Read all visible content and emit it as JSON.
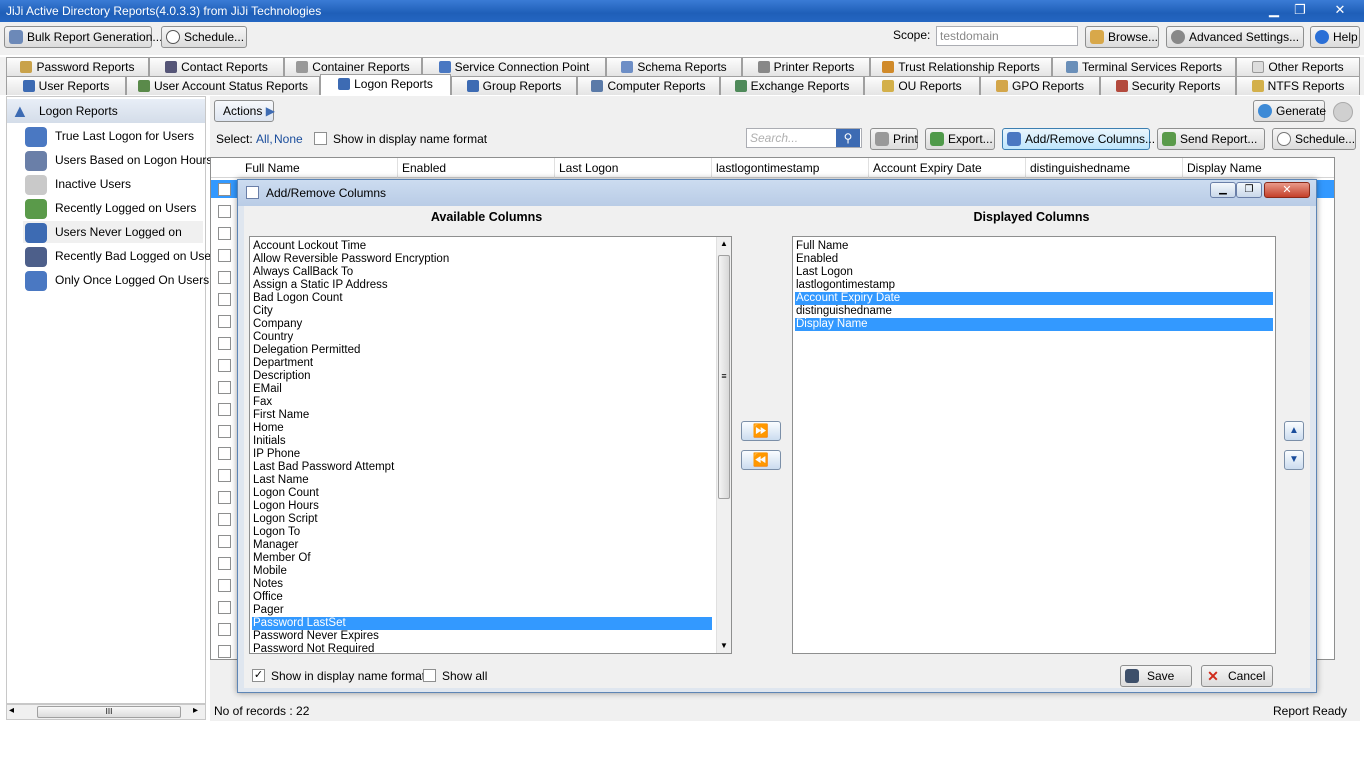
{
  "window": {
    "title": "JiJi Active Directory Reports(4.0.3.3) from JiJi Technologies",
    "min": "▁",
    "max": "❐",
    "close": "✕"
  },
  "toolbar": {
    "bulk": "Bulk Report Generation...",
    "schedule": "Schedule...",
    "scope_label": "Scope:",
    "scope_value": "testdomain",
    "browse": "Browse...",
    "advanced": "Advanced  Settings...",
    "help": "Help"
  },
  "tabs_row1": [
    "Password Reports",
    "Contact Reports",
    "Container Reports",
    "Service Connection Point",
    "Schema Reports",
    "Printer Reports",
    "Trust Relationship Reports",
    "Terminal Services Reports",
    "Other Reports"
  ],
  "tabs_row2": [
    "User Reports",
    "User Account Status Reports",
    "Logon Reports",
    "Group Reports",
    "Computer Reports",
    "Exchange Reports",
    "OU Reports",
    "GPO Reports",
    "Security Reports",
    "NTFS Reports"
  ],
  "active_tab": "Logon Reports",
  "sidebar": {
    "header": "Logon Reports",
    "items": [
      "True Last Logon for Users",
      "Users Based on Logon Hours",
      "Inactive Users",
      "Recently Logged on Users",
      "Users Never Logged on",
      "Recently Bad Logged on Users",
      "Only Once Logged On Users"
    ],
    "selected": "Users Never Logged on",
    "scroll_left": "◂",
    "scroll_right": "▸",
    "scroll_grip": "III"
  },
  "actions": {
    "label": "Actions",
    "arrow": "▶",
    "generate": "Generate"
  },
  "selectbar": {
    "select_label": "Select:",
    "all": "All,",
    "none": "None",
    "show_display": "Show in display name format",
    "search_placeholder": "Search...",
    "print": "Print",
    "export": "Export...",
    "addremove": "Add/Remove Columns...",
    "send": "Send Report...",
    "schedule": "Schedule..."
  },
  "grid": {
    "columns": [
      "Full Name",
      "Enabled",
      "Last Logon",
      "lastlogontimestamp",
      "Account Expiry Date",
      "distinguishedname",
      "Display Name"
    ]
  },
  "dialog": {
    "title": "Add/Remove Columns",
    "available_header": "Available Columns",
    "displayed_header": "Displayed Columns",
    "available": [
      "Account Lockout Time",
      "Allow Reversible Password Encryption",
      "Always CallBack To",
      "Assign a Static IP Address",
      "Bad Logon Count",
      "City",
      "Company",
      "Country",
      "Delegation Permitted",
      "Department",
      "Description",
      "EMail",
      "Fax",
      "First Name",
      "Home",
      "Initials",
      "IP Phone",
      "Last Bad Password Attempt",
      "Last Name",
      "Logon Count",
      "Logon Hours",
      "Logon Script",
      "Logon To",
      "Manager",
      "Member Of",
      "Mobile",
      "Notes",
      "Office",
      "Pager",
      "Password LastSet",
      "Password Never Expires",
      "Password Not Required"
    ],
    "available_selected": "Password LastSet",
    "displayed": [
      "Full Name",
      "Enabled",
      "Last Logon",
      "lastlogontimestamp",
      "Account Expiry Date",
      "distinguishedname",
      "Display Name"
    ],
    "displayed_selected": [
      "Account Expiry Date",
      "Display Name"
    ],
    "add_symbol": "⏩",
    "remove_symbol": "⏪",
    "up_symbol": "▲",
    "down_symbol": "▼",
    "scroll_up": "▲",
    "scroll_down": "▼",
    "scroll_grip": "≡",
    "show_display_name": "Show in display name format",
    "show_display_name_checked": true,
    "show_all": "Show all",
    "show_all_checked": false,
    "save": "Save",
    "cancel": "Cancel"
  },
  "status": {
    "records": "No of records : 22",
    "state": "Report Ready"
  },
  "colors": {
    "accent": "#3399ff",
    "titlebar": "#2466c2"
  }
}
